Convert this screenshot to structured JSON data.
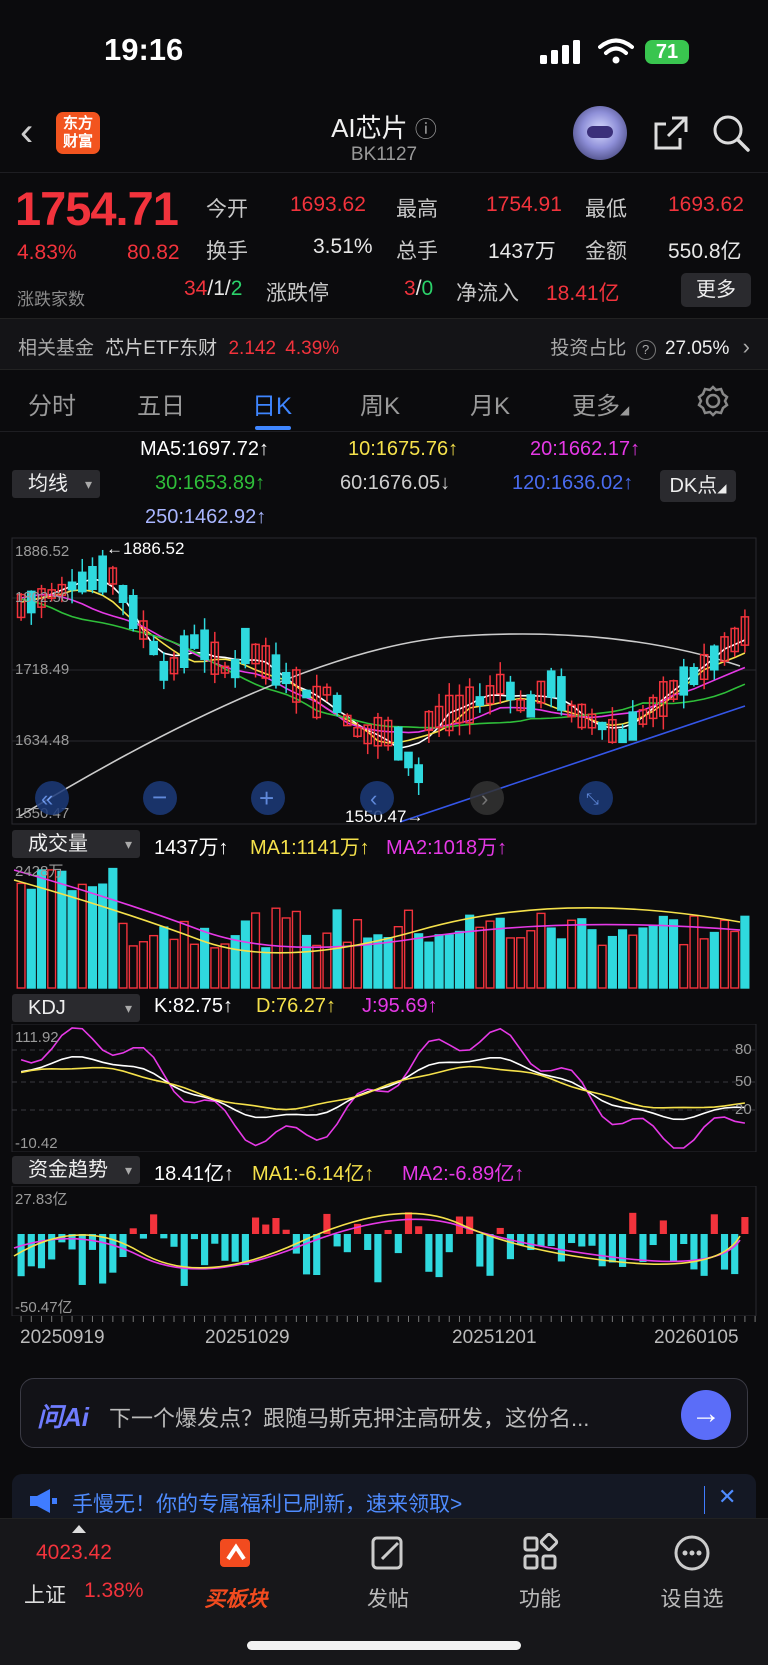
{
  "status": {
    "time": "19:16",
    "battery": "71"
  },
  "nav": {
    "back": "‹",
    "logo_line1": "东方",
    "logo_line2": "财富",
    "title": "AI芯片",
    "info": "ⓘ",
    "code": "BK1127"
  },
  "quote": {
    "price": "1754.71",
    "pct": "4.83%",
    "change": "80.82",
    "open_label": "今开",
    "open": "1693.62",
    "high_label": "最高",
    "high": "1754.91",
    "low_label": "最低",
    "low": "1693.62",
    "turnover_label": "换手",
    "turnover": "3.51%",
    "volume_label": "总手",
    "volume": "1437万",
    "amount_label": "金额",
    "amount": "550.8亿",
    "breadth_label": "涨跌家数",
    "up": "34",
    "sep1": "/",
    "flat": "1",
    "sep2": "/",
    "down": "2",
    "limit_label": "涨跌停",
    "limit_up": "3",
    "sep3": "/",
    "limit_down": "0",
    "inflow_label": "净流入",
    "inflow": "18.41亿",
    "more": "更多"
  },
  "fund": {
    "label": "相关基金",
    "name": "芯片ETF东财",
    "price": "2.142",
    "pct": "4.39%",
    "ratio_label": "投资占比",
    "ratio_icon": "?",
    "ratio": "27.05%",
    "chevron": "›"
  },
  "tabs": [
    "分时",
    "五日",
    "日K",
    "周K",
    "月K",
    "更多"
  ],
  "active_tab": 2,
  "ma": {
    "selector": "均线",
    "ma5": "MA5:1697.72↑",
    "ma10": "10:1675.76↑",
    "ma20": "20:1662.17↑",
    "ma30": "30:1653.89↑",
    "ma60": "60:1676.05↓",
    "ma120": "120:1636.02↑",
    "ma250": "250:1462.92↑",
    "dk": "DK点"
  },
  "kline": {
    "y_labels": [
      "1886.52",
      "1802.50",
      "1718.49",
      "1634.48",
      "1550.47"
    ],
    "max_label": "←1886.52",
    "min_label": "1550.47→",
    "colors": {
      "up": "#f2333c",
      "down": "#2fd9de",
      "ma5": "#ffffff",
      "ma10": "#f5e14b",
      "ma20": "#e639e6",
      "ma30": "#2fbf3a",
      "ma60": "#cccccc",
      "ma120": "#3556e8"
    }
  },
  "volume": {
    "selector": "成交量",
    "value": "1437万↑",
    "ma1": "MA1:1141万↑",
    "ma2": "MA2:1018万↑",
    "top_label": "2428万"
  },
  "kdj": {
    "selector": "KDJ",
    "k": "K:82.75↑",
    "d": "D:76.27↑",
    "j": "J:95.69↑",
    "top": "111.92",
    "bottom": "-10.42",
    "l80": "80",
    "l50": "50",
    "l20": "20"
  },
  "flow": {
    "selector": "资金趋势",
    "value": "18.41亿↑",
    "ma1": "MA1:-6.14亿↑",
    "ma2": "MA2:-6.89亿↑",
    "top": "27.83亿",
    "bottom": "-50.47亿"
  },
  "dates": [
    "20250919",
    "20251029",
    "20251201",
    "20260105"
  ],
  "ai": {
    "label": "问Ai",
    "text": "下一个爆发点？跟随马斯克押注高研发，这份名...",
    "go": "→"
  },
  "promo": {
    "text": "手慢无！你的专属福利已刷新，速来领取>",
    "close": "✕"
  },
  "bottom": {
    "index_value": "4023.42",
    "index_name": "上证",
    "index_pct": "1.38%",
    "buy": "买板块",
    "post": "发帖",
    "func": "功能",
    "watch": "设自选"
  }
}
